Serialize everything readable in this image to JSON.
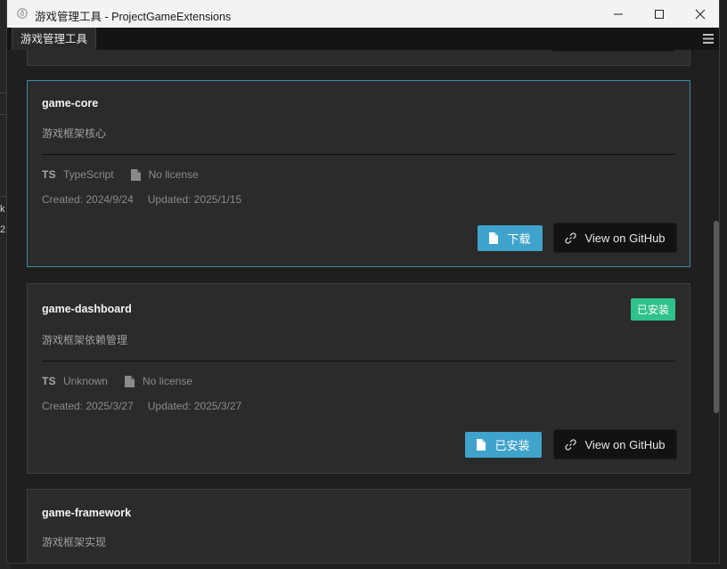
{
  "window": {
    "title": "游戏管理工具 - ProjectGameExtensions"
  },
  "tab": {
    "label": "游戏管理工具"
  },
  "background": {
    "glyph_1": "k",
    "glyph_2": "2"
  },
  "cards": [
    {
      "name": "game-core",
      "description": "游戏框架核心",
      "language": "TypeScript",
      "license": "No license",
      "created": "Created: 2024/9/24",
      "updated": "Updated: 2025/1/15",
      "action_label": "下载",
      "github_label": "View on GitHub"
    },
    {
      "name": "game-dashboard",
      "badge": "已安装",
      "description": "游戏框架依赖管理",
      "language": "Unknown",
      "license": "No license",
      "created": "Created: 2025/3/27",
      "updated": "Updated: 2025/3/27",
      "action_label": "已安装",
      "github_label": "View on GitHub"
    },
    {
      "name": "game-framework",
      "description": "游戏框架实现"
    }
  ],
  "colors": {
    "accent": "#3fa3cc",
    "installed": "#2fc28c",
    "selected_border": "#3a8aa3"
  },
  "ts_badge": "TS"
}
